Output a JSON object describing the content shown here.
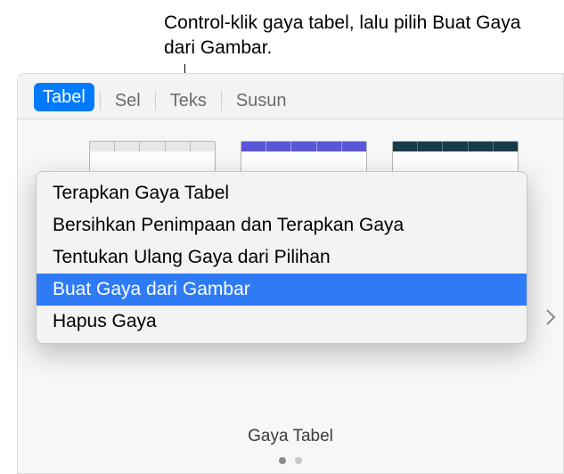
{
  "callout": {
    "text": "Control-klik gaya tabel, lalu pilih Buat Gaya dari Gambar."
  },
  "tabs": {
    "items": [
      {
        "label": "Tabel",
        "active": true
      },
      {
        "label": "Sel",
        "active": false
      },
      {
        "label": "Teks",
        "active": false
      },
      {
        "label": "Susun",
        "active": false
      }
    ]
  },
  "styles": {
    "label": "Gaya Tabel",
    "items": [
      {
        "name": "light"
      },
      {
        "name": "purple"
      },
      {
        "name": "dark-teal"
      }
    ]
  },
  "context_menu": {
    "items": [
      {
        "label": "Terapkan Gaya Tabel",
        "highlight": false
      },
      {
        "label": "Bersihkan Penimpaan dan Terapkan Gaya",
        "highlight": false
      },
      {
        "label": "Tentukan Ulang Gaya dari Pilihan",
        "highlight": false
      },
      {
        "label": "Buat Gaya dari Gambar",
        "highlight": true
      },
      {
        "label": "Hapus Gaya",
        "highlight": false
      }
    ]
  },
  "pager": {
    "count": 2,
    "active": 0
  }
}
